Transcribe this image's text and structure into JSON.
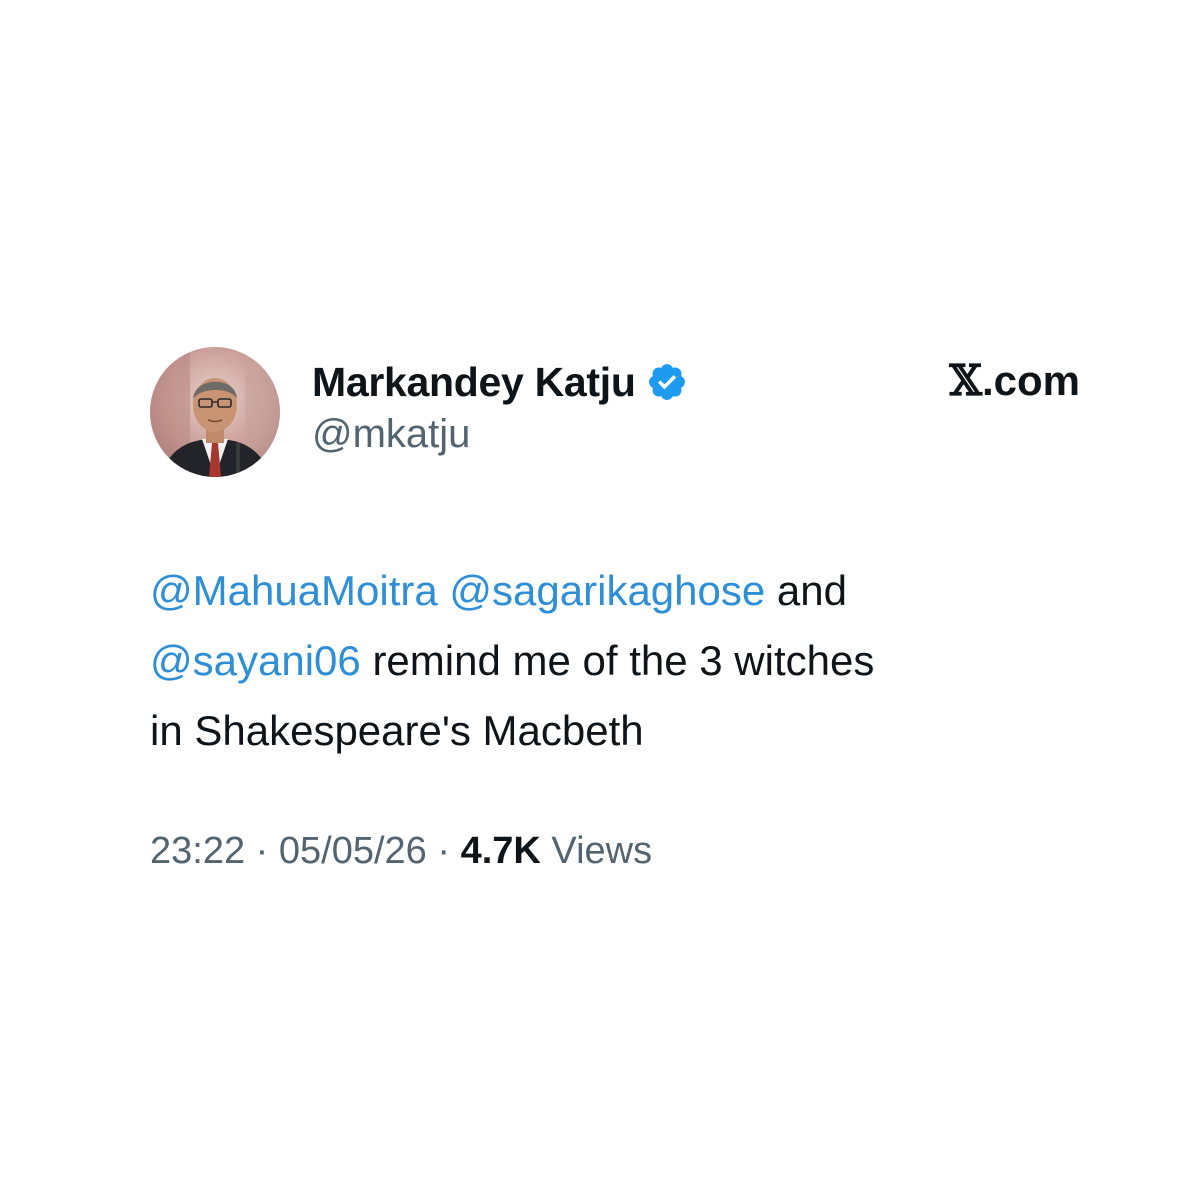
{
  "tweet": {
    "author": {
      "display_name": "Markandey Katju",
      "handle": "@mkatju",
      "verified": true,
      "verified_icon": "verified-badge-icon",
      "verified_color": "#1d9bf0"
    },
    "brand": {
      "x_glyph": "𝕏",
      "suffix": ".com"
    },
    "text": {
      "mention_1": "@MahuaMoitra",
      "mention_2": "@sagarikaghose",
      "and_word": "and",
      "mention_3": "@sayani06",
      "rest_line_2": "remind me of the 3 witches",
      "line_3": "in Shakespeare's Macbeth"
    },
    "meta": {
      "time": "23:22",
      "separator": "·",
      "date": "05/05/26",
      "views_count": "4.7K",
      "views_label": "Views"
    },
    "colors": {
      "mention": "#2f8fd6",
      "text": "#0f1419",
      "secondary": "#536471",
      "background": "#ffffff"
    }
  }
}
